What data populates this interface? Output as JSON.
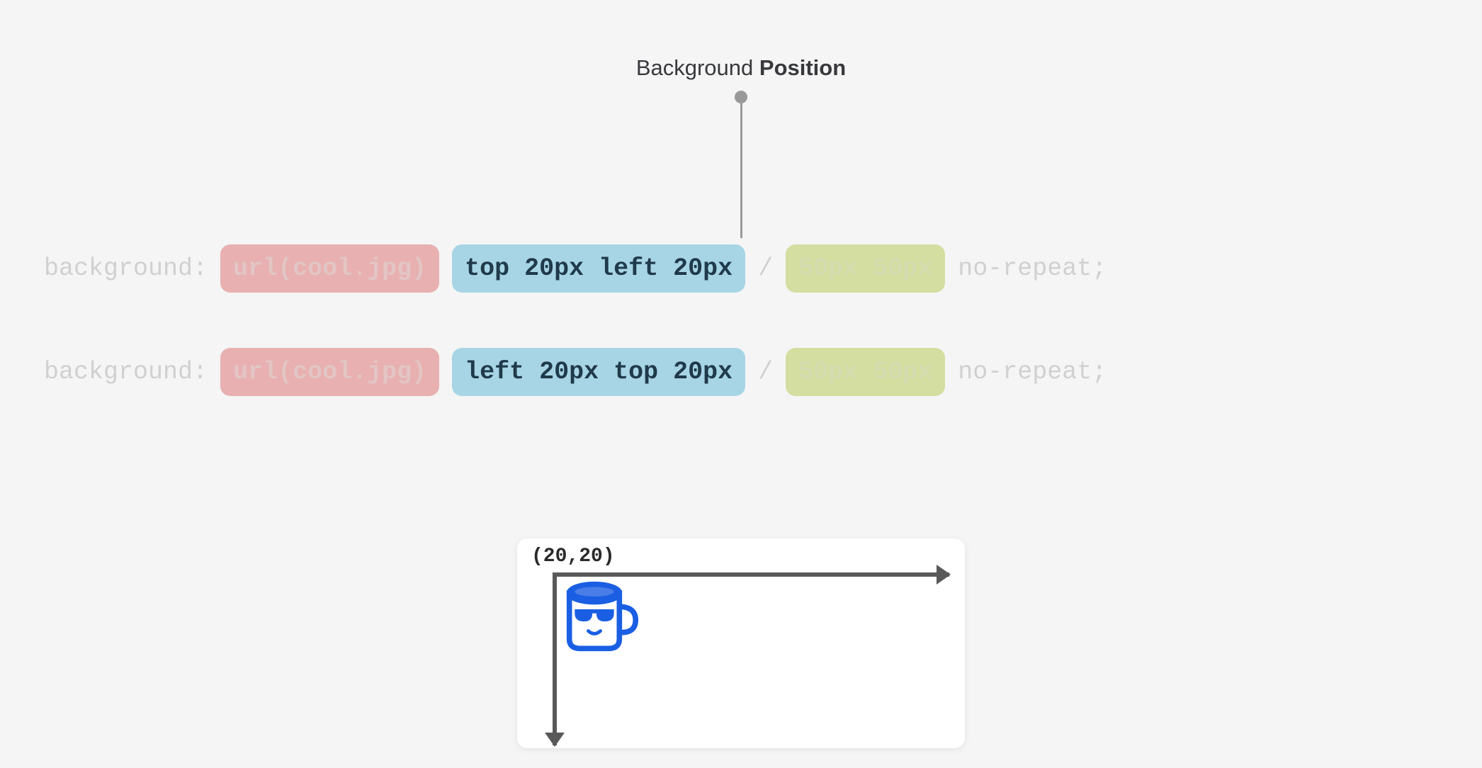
{
  "title": {
    "prefix": "Background ",
    "bold": "Position"
  },
  "code_lines": [
    {
      "property": "background:",
      "url_chip": "url(cool.jpg)",
      "position_chip": "top 20px left 20px",
      "separator": "/",
      "size_chip": "50px 50px",
      "repeat": "no-repeat;"
    },
    {
      "property": "background:",
      "url_chip": "url(cool.jpg)",
      "position_chip": "left 20px top 20px",
      "separator": "/",
      "size_chip": "50px 50px",
      "repeat": "no-repeat;"
    }
  ],
  "demo": {
    "coord_label": "(20,20)"
  },
  "colors": {
    "chip_red_bg": "#e8b0b0",
    "chip_blue_bg": "#a8d5e5",
    "chip_green_bg": "#d3dea0",
    "mug_blue": "#1a5fe3",
    "axis_gray": "#595959"
  }
}
